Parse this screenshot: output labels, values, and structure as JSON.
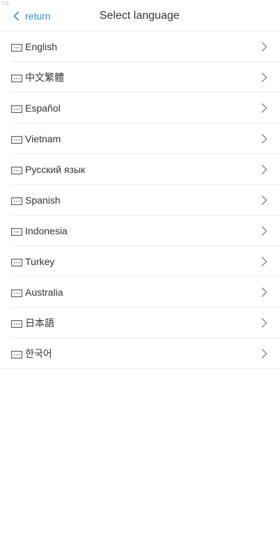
{
  "corner_tag": "T8",
  "header": {
    "back_label": "return",
    "title": "Select language"
  },
  "icons": {
    "back": "chevron-left-icon",
    "row": "keyboard-icon",
    "row_arrow": "chevron-right-icon"
  },
  "colors": {
    "accent": "#2d8cf0",
    "text": "#333333",
    "divider": "#ececec"
  },
  "languages": [
    {
      "label": "English"
    },
    {
      "label": "中文繁體"
    },
    {
      "label": "Español"
    },
    {
      "label": "Vietnam"
    },
    {
      "label": "Русский язык"
    },
    {
      "label": "Spanish"
    },
    {
      "label": "Indonesia"
    },
    {
      "label": "Turkey"
    },
    {
      "label": "Australia"
    },
    {
      "label": "日本語"
    },
    {
      "label": "한국어"
    }
  ]
}
